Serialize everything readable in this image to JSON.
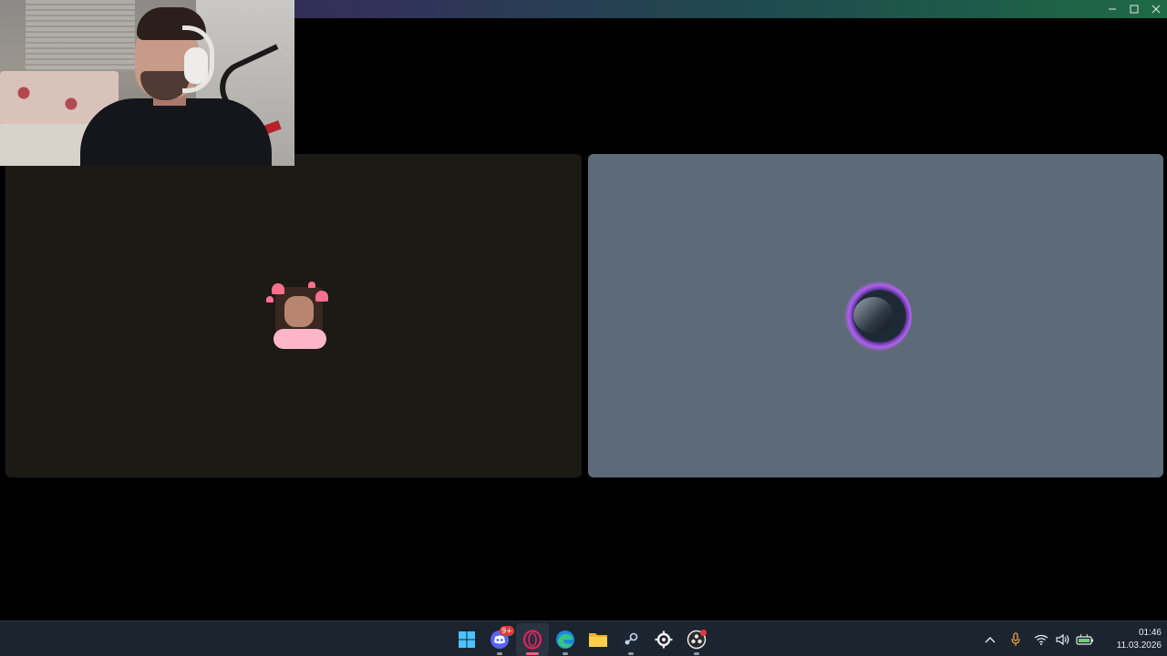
{
  "window": {
    "controls": {
      "minimize_icon": "minimize-icon",
      "maximize_icon": "maximize-icon",
      "close_icon": "close-icon"
    },
    "titlebar_gradient": [
      "#2b2446",
      "#1e6a45"
    ]
  },
  "call": {
    "participants": [
      {
        "tile_color": "#1b1a15",
        "avatar": "avatar-with-hearts"
      },
      {
        "tile_color": "#5d6b78",
        "avatar": "avatar-purple-ring"
      }
    ]
  },
  "taskbar": {
    "apps": [
      {
        "name": "windows-start",
        "icon": "windows-logo-icon"
      },
      {
        "name": "discord",
        "icon": "discord-icon",
        "badge": "9+"
      },
      {
        "name": "opera",
        "icon": "opera-icon",
        "active": true
      },
      {
        "name": "edge",
        "icon": "edge-icon"
      },
      {
        "name": "file-explorer",
        "icon": "folder-icon"
      },
      {
        "name": "steam",
        "icon": "steam-icon"
      },
      {
        "name": "steelseries",
        "icon": "steelseries-icon"
      },
      {
        "name": "obs",
        "icon": "obs-icon"
      }
    ],
    "tray": {
      "icons": [
        "chevron-up-icon",
        "microphone-icon",
        "wifi-icon",
        "speaker-icon",
        "battery-icon"
      ],
      "time": "01:46",
      "date": "11.03.2026"
    },
    "accent_color": "#e06a7d"
  }
}
